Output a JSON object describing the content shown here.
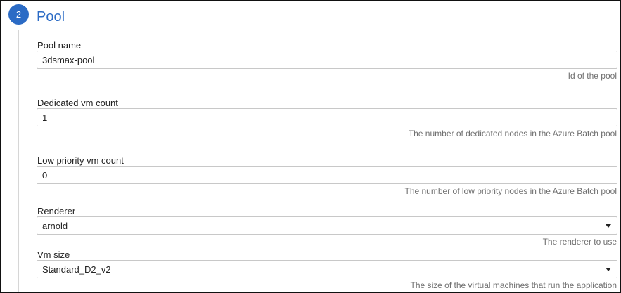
{
  "section": {
    "step_number": "2",
    "title": "Pool"
  },
  "fields": {
    "pool_name": {
      "label": "Pool name",
      "value": "3dsmax-pool",
      "help": "Id of the pool"
    },
    "dedicated_vm_count": {
      "label": "Dedicated vm count",
      "value": "1",
      "help": "The number of dedicated nodes in the Azure Batch pool"
    },
    "low_priority_vm_count": {
      "label": "Low priority vm count",
      "value": "0",
      "help": "The number of low priority nodes in the Azure Batch pool"
    },
    "renderer": {
      "label": "Renderer",
      "selected": "arnold",
      "help": "The renderer to use",
      "icon": "chevron-down-icon"
    },
    "vm_size": {
      "label": "Vm size",
      "selected": "Standard_D2_v2",
      "help": "The size of the virtual machines that run the application",
      "icon": "chevron-down-icon"
    }
  },
  "colors": {
    "accent": "#2b6bc5",
    "help_text": "#707070",
    "input_border": "#c8c8c8"
  }
}
